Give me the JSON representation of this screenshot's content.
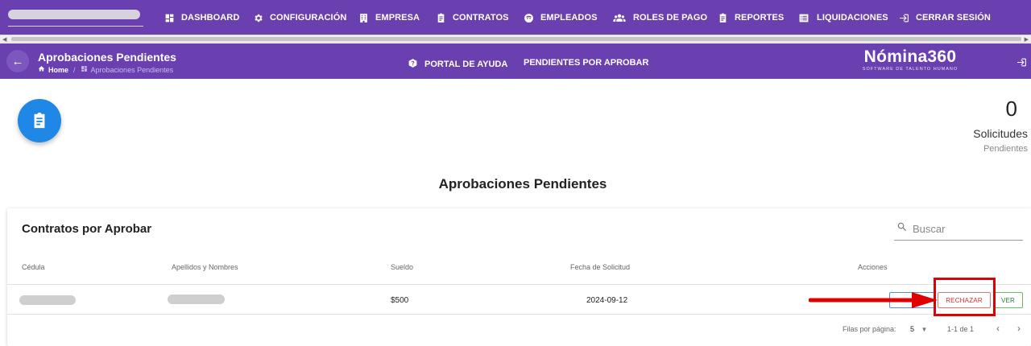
{
  "nav": {
    "items": [
      {
        "label": "DASHBOARD",
        "icon": "dashboard-icon"
      },
      {
        "label": "CONFIGURACIÓN",
        "icon": "gear-icon"
      },
      {
        "label": "EMPRESA",
        "icon": "building-icon"
      },
      {
        "label": "CONTRATOS",
        "icon": "clipboard-icon"
      },
      {
        "label": "EMPLEADOS",
        "icon": "face-icon"
      },
      {
        "label": "ROLES DE PAGO",
        "icon": "group-icon"
      },
      {
        "label": "REPORTES",
        "icon": "clipboard-icon"
      },
      {
        "label": "LIQUIDACIONES",
        "icon": "list-icon"
      },
      {
        "label": "CERRAR SESIÓN",
        "icon": "logout-icon"
      }
    ]
  },
  "header": {
    "title": "Aprobaciones Pendientes",
    "breadcrumb": {
      "home": "Home",
      "current": "Aprobaciones Pendientes"
    },
    "links": {
      "help": "PORTAL DE AYUDA",
      "pending": "PENDIENTES POR APROBAR"
    },
    "brand": {
      "name": "Nómina360",
      "tagline": "SOFTWARE DE TALENTO HUMANO"
    }
  },
  "stats": {
    "count": "0",
    "label": "Solicitudes",
    "sublabel": "Pendientes"
  },
  "section_title": "Aprobaciones Pendientes",
  "table": {
    "title": "Contratos por Aprobar",
    "search_placeholder": "Buscar",
    "columns": [
      "Cédula",
      "Apellidos y Nombres",
      "Sueldo",
      "Fecha de Solicitud",
      "Acciones"
    ],
    "rows": [
      {
        "cedula": "",
        "nombres": "",
        "sueldo": "$500",
        "fecha": "2024-09-12"
      }
    ],
    "actions": {
      "reject": "RECHAZAR",
      "view": "VER"
    },
    "footer": {
      "rows_per_page_label": "Filas por página:",
      "rows_per_page": "5",
      "range": "1-1 de 1"
    }
  },
  "colors": {
    "primary": "#6a3fb0",
    "accent_blue": "#1f87e5",
    "annotation_red": "#e00000"
  }
}
